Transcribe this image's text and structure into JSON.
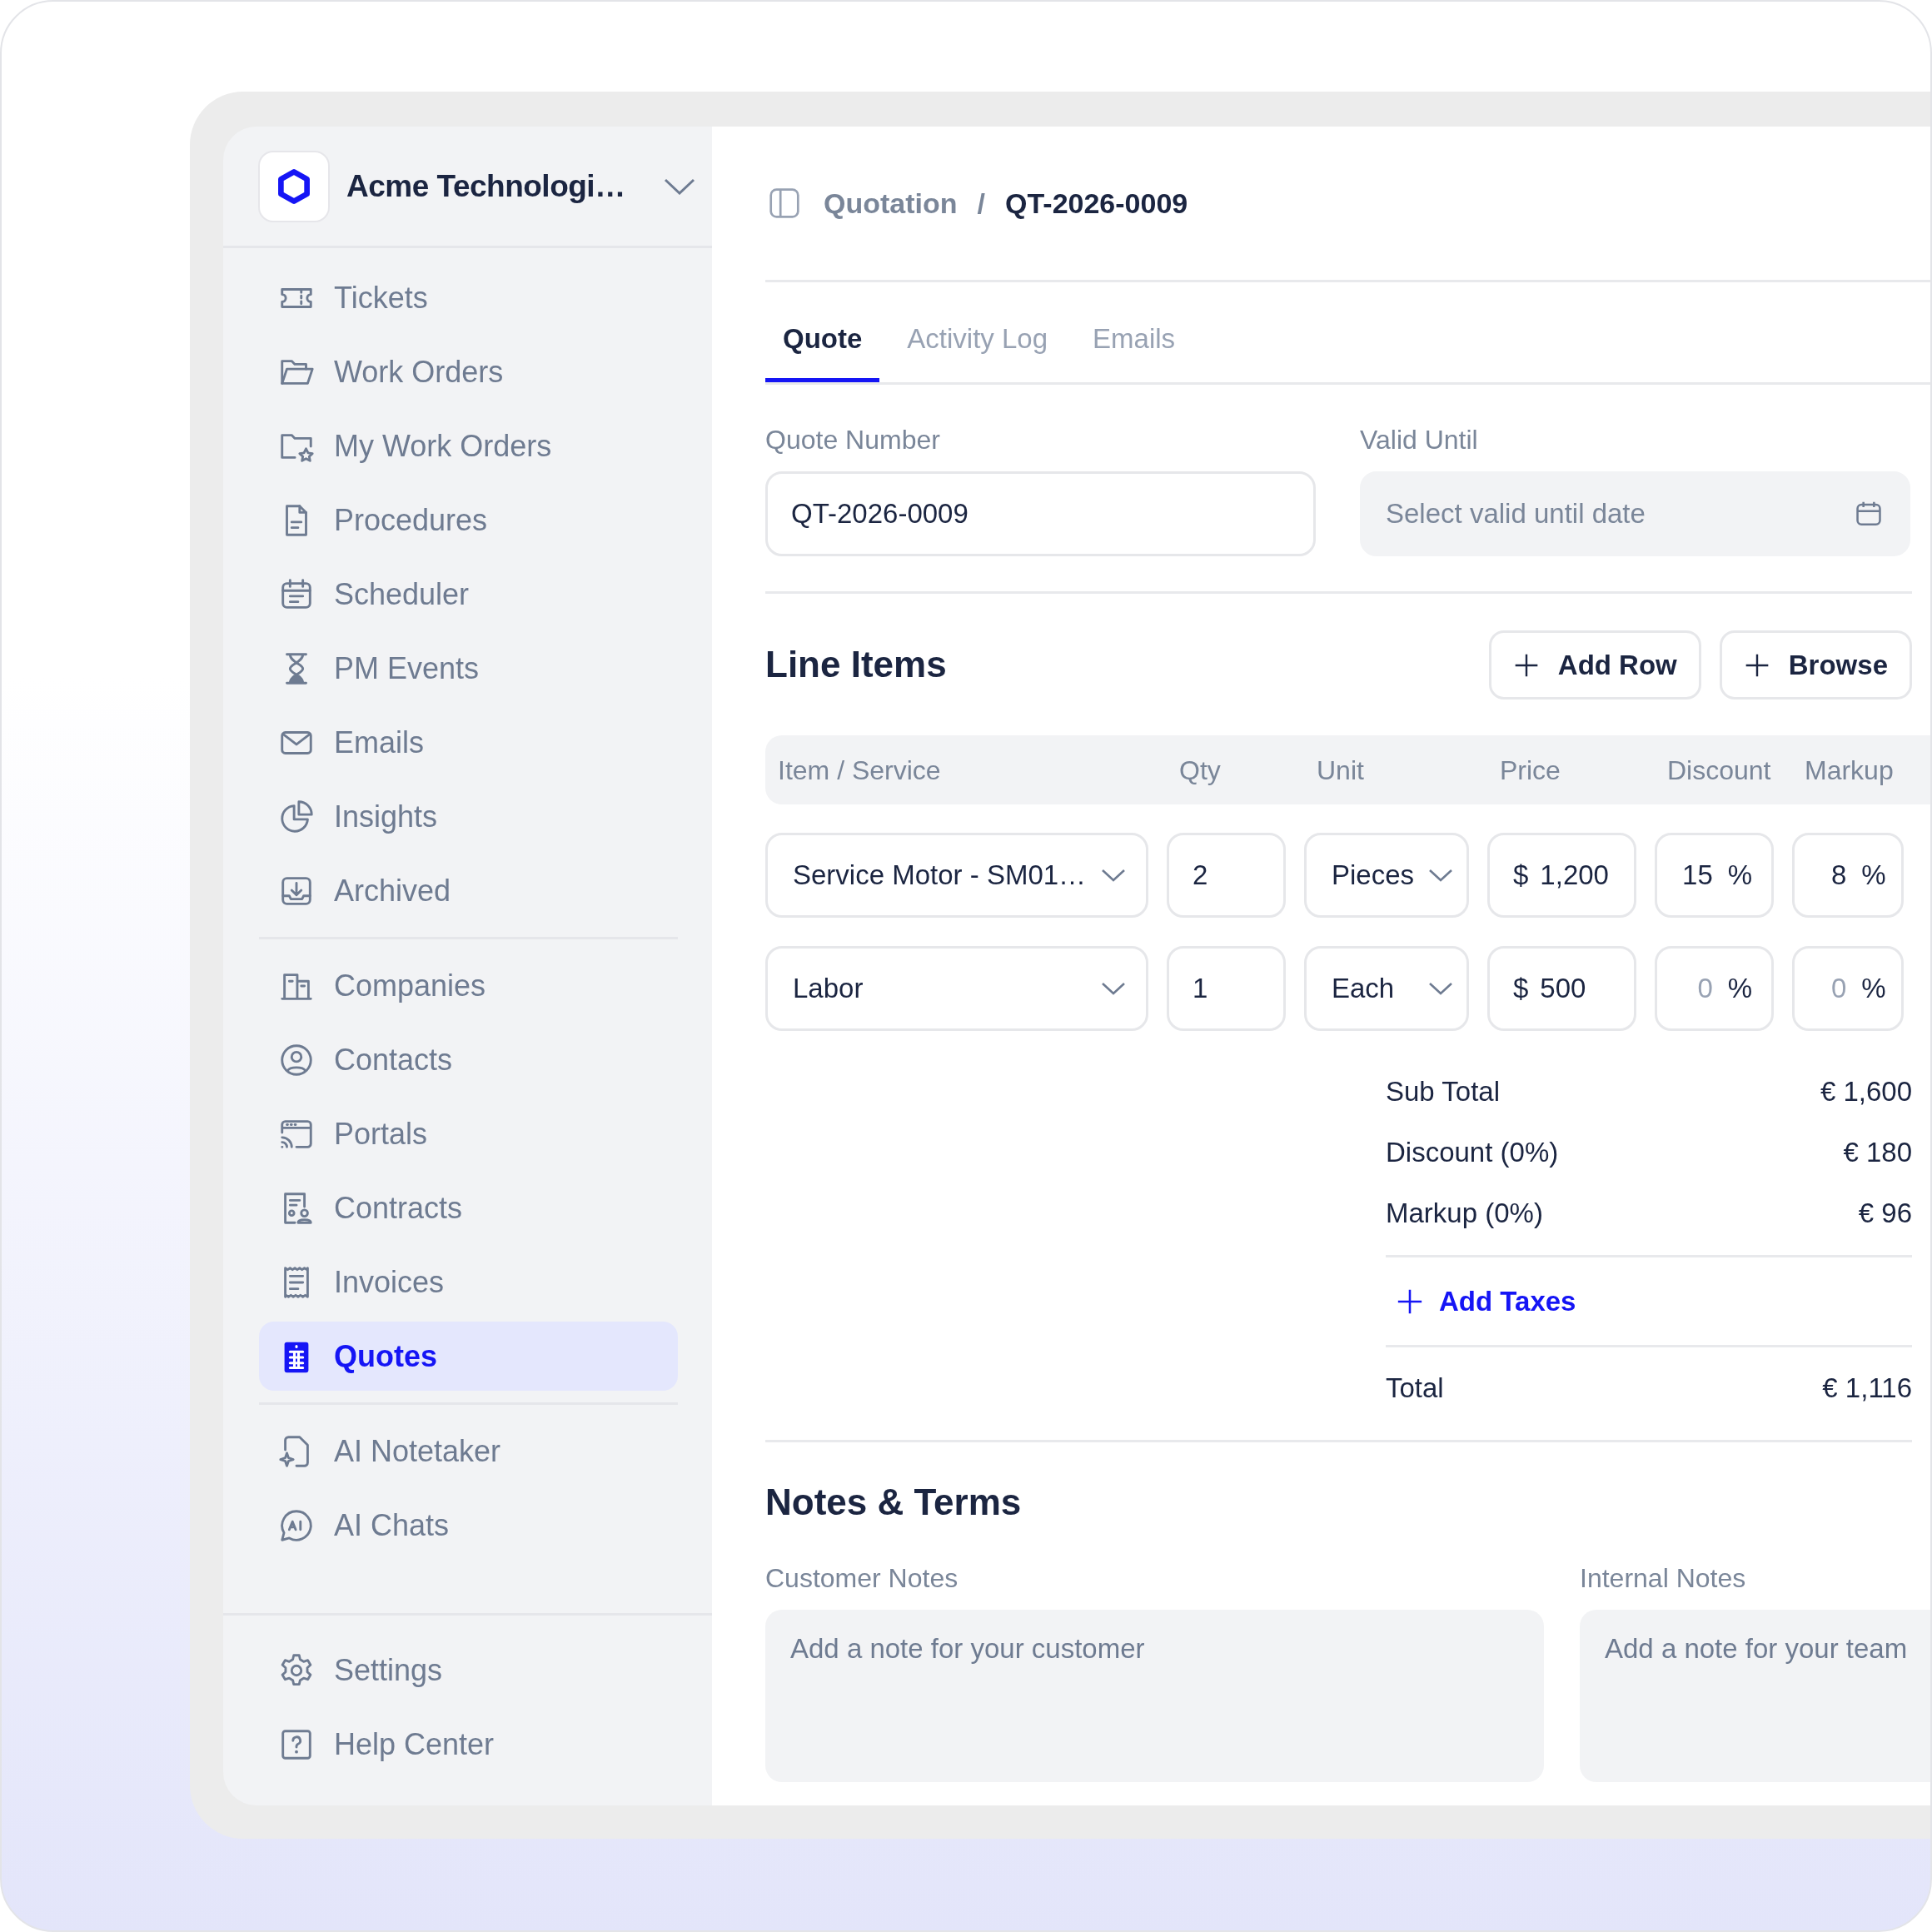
{
  "org": {
    "name": "Acme Technologi…"
  },
  "sidebar": {
    "sections": [
      {
        "items": [
          {
            "label": "Tickets",
            "selected": false
          },
          {
            "label": "Work Orders",
            "selected": false
          },
          {
            "label": "My Work Orders",
            "selected": false
          },
          {
            "label": "Procedures",
            "selected": false
          },
          {
            "label": "Scheduler",
            "selected": false
          },
          {
            "label": "PM Events",
            "selected": false
          },
          {
            "label": "Emails",
            "selected": false
          },
          {
            "label": "Insights",
            "selected": false
          },
          {
            "label": "Archived",
            "selected": false
          }
        ]
      },
      {
        "items": [
          {
            "label": "Companies",
            "selected": false
          },
          {
            "label": "Contacts",
            "selected": false
          },
          {
            "label": "Portals",
            "selected": false
          },
          {
            "label": "Contracts",
            "selected": false
          },
          {
            "label": "Invoices",
            "selected": false
          },
          {
            "label": "Quotes",
            "selected": true
          }
        ]
      },
      {
        "items": [
          {
            "label": "AI Notetaker",
            "selected": false
          },
          {
            "label": "AI Chats",
            "selected": false
          }
        ]
      }
    ],
    "footer": [
      {
        "label": "Settings",
        "selected": false
      },
      {
        "label": "Help Center",
        "selected": false
      }
    ]
  },
  "breadcrumb": {
    "items": [
      "Quotation",
      "QT-2026-0009"
    ],
    "separator": "/"
  },
  "tabs": [
    {
      "label": "Quote",
      "selected": true
    },
    {
      "label": "Activity Log",
      "selected": false
    },
    {
      "label": "Emails",
      "selected": false
    }
  ],
  "fields": {
    "quote_number": {
      "label": "Quote Number",
      "value": "QT-2026-0009"
    },
    "valid_until": {
      "label": "Valid Until",
      "placeholder": "Select valid until date"
    }
  },
  "line_items": {
    "title": "Line Items",
    "buttons": [
      "Add Row",
      "Browse"
    ],
    "columns": [
      "Item / Service",
      "Qty",
      "Unit",
      "Price",
      "Discount",
      "Markup"
    ],
    "rows": [
      {
        "item": "Service Motor - SM01…",
        "qty": "2",
        "unit": "Pieces",
        "currency": "$",
        "price": "1,200",
        "discount": {
          "value": "15",
          "unit": "%"
        },
        "markup": {
          "value": "8",
          "unit": "%"
        }
      },
      {
        "item": "Labor",
        "qty": "1",
        "unit": "Each",
        "currency": "$",
        "price": "500",
        "discount": {
          "placeholder": "0",
          "unit": "%"
        },
        "markup": {
          "placeholder": "0",
          "unit": "%"
        }
      }
    ]
  },
  "summary": {
    "rows": [
      {
        "label": "Sub Total",
        "value": "€ 1,600"
      },
      {
        "label": "Discount (0%)",
        "value": "€ 180"
      },
      {
        "label": "Markup (0%)",
        "value": "€ 96"
      }
    ],
    "add_taxes": "Add Taxes",
    "total": {
      "label": "Total",
      "value": "€ 1,116"
    }
  },
  "notes": {
    "title": "Notes & Terms",
    "customer": {
      "label": "Customer Notes",
      "placeholder": "Add a note for your customer"
    },
    "internal": {
      "label": "Internal Notes",
      "placeholder": "Add a note for your team"
    }
  }
}
